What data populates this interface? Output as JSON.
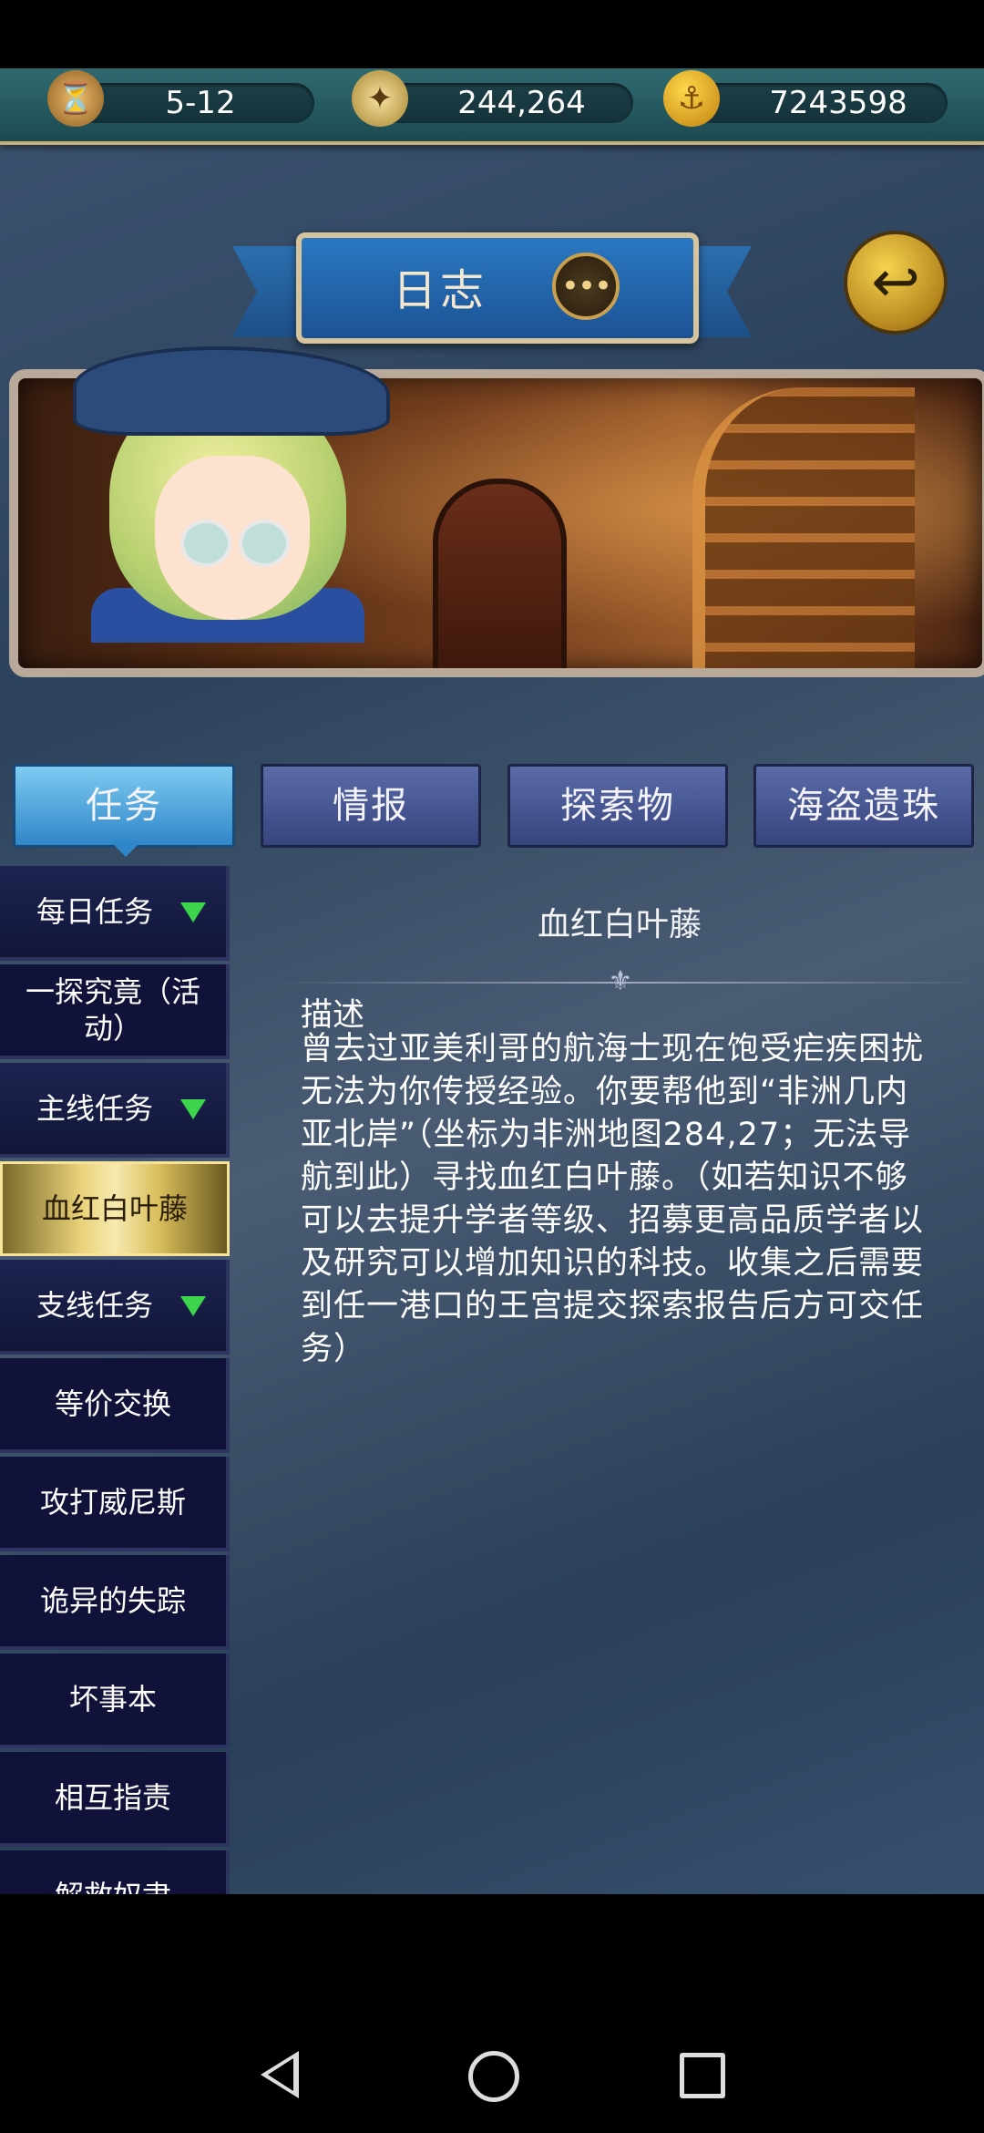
{
  "resources": {
    "date": "5-12",
    "compass_value": "244,264",
    "gold": "7243598"
  },
  "icons": {
    "hourglass": "hourglass-icon",
    "compass": "compass-icon",
    "gold_coin": "anchor-coin-icon",
    "chat": "chat-bubble-icon",
    "back": "back-arrow-icon"
  },
  "header": {
    "title": "日志"
  },
  "tabs": [
    {
      "label": "任务",
      "active": true
    },
    {
      "label": "情报",
      "active": false
    },
    {
      "label": "探索物",
      "active": false
    },
    {
      "label": "海盗遗珠",
      "active": false
    }
  ],
  "sidebar": {
    "items": [
      {
        "label": "每日任务",
        "type": "category"
      },
      {
        "label": "一探究竟（活动）",
        "type": "item"
      },
      {
        "label": "主线任务",
        "type": "category"
      },
      {
        "label": "血红白叶藤",
        "type": "selected"
      },
      {
        "label": "支线任务",
        "type": "category"
      },
      {
        "label": "等价交换",
        "type": "item"
      },
      {
        "label": "攻打威尼斯",
        "type": "item"
      },
      {
        "label": "诡异的失踪",
        "type": "item"
      },
      {
        "label": "坏事本",
        "type": "item"
      },
      {
        "label": "相互指责",
        "type": "item"
      },
      {
        "label": "解救奴隶",
        "type": "item"
      }
    ]
  },
  "detail": {
    "title": "血红白叶藤",
    "desc_label": "描述",
    "desc_body": "曾去过亚美利哥的航海士现在饱受疟疾困扰无法为你传授经验。你要帮他到“非洲几内亚北岸”（坐标为非洲地图284,27；无法导航到此）寻找血红白叶藤。（如若知识不够可以去提升学者等级、招募更高品质学者以及研究可以增加知识的科技。收集之后需要到任一港口的王宫提交探索报告后方可交任务）"
  },
  "colors": {
    "active_tab": "#2f86c8",
    "inactive_tab": "#4a5a96",
    "selected_item": "#e9d27a",
    "category_arrow": "#3cd44a",
    "sidebar_bg": "#10123a"
  }
}
